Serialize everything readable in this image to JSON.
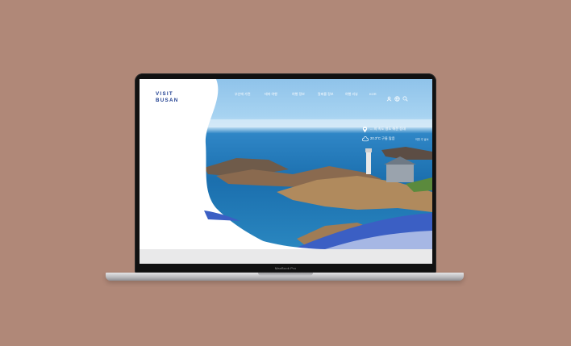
{
  "device": {
    "model_label": "MacBook Pro"
  },
  "site": {
    "logo": {
      "line1": "VISIT",
      "line2": "BUSAN"
    },
    "nav": {
      "items": [
        {
          "label": "부산에 가면"
        },
        {
          "label": "테마 여행"
        },
        {
          "label": "여행 정보"
        },
        {
          "label": "알짜를 정보"
        },
        {
          "label": "여행 리뷰"
        }
      ],
      "lang_label": "KOR"
    },
    "info": {
      "place": "... 지 속도 영도 해운 등대",
      "weather": "20.3°C 구름 많음",
      "weather_sub": "이번 주 날씨"
    }
  },
  "colors": {
    "background": "#b08878",
    "brand": "#1b3b8e",
    "accent_wave": "#3b5fc4"
  }
}
